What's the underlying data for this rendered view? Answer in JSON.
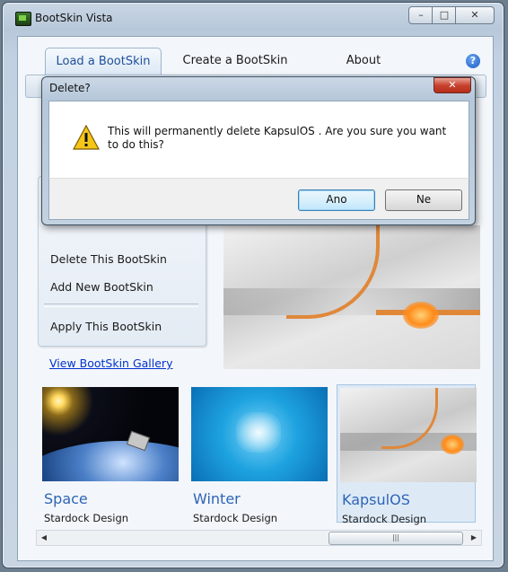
{
  "window": {
    "title": "BootSkin Vista",
    "controls": {
      "minimize": "–",
      "maximize": "□",
      "close": "✕"
    }
  },
  "tabs": [
    {
      "label": "Load a BootSkin",
      "active": true
    },
    {
      "label": "Create a BootSkin",
      "active": false
    },
    {
      "label": "About",
      "active": false
    }
  ],
  "help_icon": "?",
  "sidebar": {
    "items": [
      {
        "label": "Delete This BootSkin"
      },
      {
        "label": "Add New BootSkin"
      },
      {
        "label": "Apply This BootSkin"
      }
    ]
  },
  "gallery_link": "View BootSkin Gallery",
  "skins": [
    {
      "name": "Space",
      "author": "Stardock Design",
      "image": "space-earth-satellite"
    },
    {
      "name": "Winter",
      "author": "Stardock Design",
      "image": "blue-snowflake"
    },
    {
      "name": "KapsulOS",
      "author": "Stardock Design",
      "image": "gray-orange-abstract",
      "selected": true
    }
  ],
  "scrollbar": {
    "left_arrow": "◀",
    "right_arrow": "▶",
    "thumb_grip": "|||"
  },
  "dialog": {
    "title": "Delete?",
    "close": "✕",
    "icon": "warning-icon",
    "message": "This will permanently delete KapsulOS .  Are you sure you want to do this?",
    "buttons": {
      "yes": "Ano",
      "no": "Ne"
    }
  },
  "colors": {
    "accent": "#2e64b8",
    "link": "#0033cc",
    "close_red": "#c8432f",
    "warning": "#f5c518"
  }
}
